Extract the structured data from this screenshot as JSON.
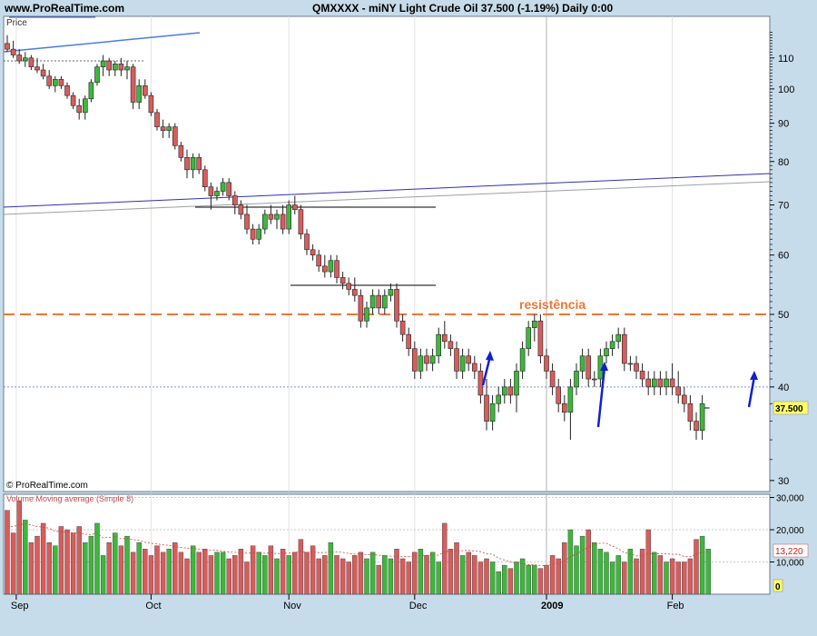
{
  "header": {
    "site": "www.ProRealTime.com",
    "title": "QMXXXX - miNY Light Crude Oil   37.500 (-1.19%)   Daily  0:00"
  },
  "price_panel": {
    "label": "Price",
    "credit": "© ProRealTime.com",
    "last_price_label": "37.500",
    "annotation": "resistência"
  },
  "volume_panel": {
    "label": "Volume Moving average (Simple 8)",
    "ma_value_label": "13,220",
    "zero_label": "0"
  },
  "colors": {
    "up": "#3cb83c",
    "down": "#d95c5c",
    "resistance": "#ee7733",
    "arrow": "#1020d0",
    "trend_blue": "#3030b0",
    "panel_bg": "#ffffff",
    "frame_bg": "#c7dcea"
  },
  "chart_data": [
    {
      "type": "candlestick",
      "scale": "log",
      "ylim": [
        29,
        125
      ],
      "y_ticks": [
        30,
        40,
        50,
        60,
        70,
        80,
        90,
        100,
        110
      ],
      "x_ticks": [
        "Sep",
        "Oct",
        "Nov",
        "Dec",
        "2009",
        "Feb"
      ],
      "resistance_level": 50,
      "reference_level": 40,
      "last_price": 37.5,
      "candles": [
        {
          "o": 115,
          "h": 118,
          "l": 112,
          "c": 113
        },
        {
          "o": 113,
          "h": 116,
          "l": 110,
          "c": 111
        },
        {
          "o": 111,
          "h": 113,
          "l": 108,
          "c": 109
        },
        {
          "o": 109,
          "h": 112,
          "l": 107,
          "c": 110
        },
        {
          "o": 110,
          "h": 111,
          "l": 106,
          "c": 107
        },
        {
          "o": 107,
          "h": 110,
          "l": 105,
          "c": 106
        },
        {
          "o": 106,
          "h": 108,
          "l": 103,
          "c": 104
        },
        {
          "o": 104,
          "h": 106,
          "l": 100,
          "c": 101
        },
        {
          "o": 101,
          "h": 104,
          "l": 99,
          "c": 103
        },
        {
          "o": 103,
          "h": 104,
          "l": 100,
          "c": 101
        },
        {
          "o": 101,
          "h": 102,
          "l": 97,
          "c": 98
        },
        {
          "o": 98,
          "h": 99,
          "l": 94,
          "c": 95
        },
        {
          "o": 95,
          "h": 97,
          "l": 91,
          "c": 93
        },
        {
          "o": 93,
          "h": 98,
          "l": 91,
          "c": 97
        },
        {
          "o": 97,
          "h": 103,
          "l": 96,
          "c": 102
        },
        {
          "o": 102,
          "h": 108,
          "l": 101,
          "c": 107
        },
        {
          "o": 107,
          "h": 111,
          "l": 104,
          "c": 109
        },
        {
          "o": 109,
          "h": 110,
          "l": 104,
          "c": 106
        },
        {
          "o": 106,
          "h": 109,
          "l": 104,
          "c": 108
        },
        {
          "o": 108,
          "h": 110,
          "l": 104,
          "c": 106
        },
        {
          "o": 106,
          "h": 109,
          "l": 103,
          "c": 107
        },
        {
          "o": 107,
          "h": 108,
          "l": 94,
          "c": 96
        },
        {
          "o": 96,
          "h": 103,
          "l": 94,
          "c": 101
        },
        {
          "o": 101,
          "h": 103,
          "l": 97,
          "c": 98
        },
        {
          "o": 98,
          "h": 99,
          "l": 92,
          "c": 93
        },
        {
          "o": 93,
          "h": 94,
          "l": 88,
          "c": 89
        },
        {
          "o": 89,
          "h": 91,
          "l": 86,
          "c": 88
        },
        {
          "o": 88,
          "h": 90,
          "l": 86,
          "c": 89
        },
        {
          "o": 89,
          "h": 90,
          "l": 83,
          "c": 84
        },
        {
          "o": 84,
          "h": 85,
          "l": 80,
          "c": 81
        },
        {
          "o": 81,
          "h": 83,
          "l": 76,
          "c": 78
        },
        {
          "o": 78,
          "h": 82,
          "l": 76,
          "c": 81
        },
        {
          "o": 81,
          "h": 82,
          "l": 77,
          "c": 78
        },
        {
          "o": 78,
          "h": 79,
          "l": 73,
          "c": 74
        },
        {
          "o": 74,
          "h": 75,
          "l": 69,
          "c": 72
        },
        {
          "o": 72,
          "h": 74,
          "l": 71,
          "c": 73
        },
        {
          "o": 73,
          "h": 76,
          "l": 72,
          "c": 75
        },
        {
          "o": 75,
          "h": 76,
          "l": 71,
          "c": 72
        },
        {
          "o": 72,
          "h": 73,
          "l": 68,
          "c": 70
        },
        {
          "o": 70,
          "h": 71,
          "l": 67,
          "c": 68
        },
        {
          "o": 68,
          "h": 70,
          "l": 64,
          "c": 65
        },
        {
          "o": 65,
          "h": 66,
          "l": 62,
          "c": 63
        },
        {
          "o": 63,
          "h": 66,
          "l": 62,
          "c": 65
        },
        {
          "o": 65,
          "h": 69,
          "l": 64,
          "c": 68
        },
        {
          "o": 68,
          "h": 70,
          "l": 66,
          "c": 67
        },
        {
          "o": 67,
          "h": 69,
          "l": 65,
          "c": 68
        },
        {
          "o": 68,
          "h": 70,
          "l": 64,
          "c": 65
        },
        {
          "o": 65,
          "h": 71,
          "l": 64,
          "c": 70
        },
        {
          "o": 70,
          "h": 72,
          "l": 68,
          "c": 69
        },
        {
          "o": 69,
          "h": 70,
          "l": 63,
          "c": 64
        },
        {
          "o": 64,
          "h": 65,
          "l": 60,
          "c": 61
        },
        {
          "o": 61,
          "h": 62,
          "l": 59,
          "c": 60
        },
        {
          "o": 60,
          "h": 61,
          "l": 57,
          "c": 58
        },
        {
          "o": 58,
          "h": 60,
          "l": 56,
          "c": 57
        },
        {
          "o": 57,
          "h": 60,
          "l": 56,
          "c": 59
        },
        {
          "o": 59,
          "h": 60,
          "l": 55,
          "c": 56
        },
        {
          "o": 56,
          "h": 57,
          "l": 54,
          "c": 55
        },
        {
          "o": 55,
          "h": 56,
          "l": 53,
          "c": 54
        },
        {
          "o": 54,
          "h": 56,
          "l": 52,
          "c": 53
        },
        {
          "o": 53,
          "h": 54,
          "l": 48,
          "c": 49
        },
        {
          "o": 49,
          "h": 52,
          "l": 48,
          "c": 51
        },
        {
          "o": 51,
          "h": 54,
          "l": 50,
          "c": 53
        },
        {
          "o": 53,
          "h": 54,
          "l": 50,
          "c": 51
        },
        {
          "o": 51,
          "h": 54,
          "l": 50,
          "c": 53
        },
        {
          "o": 53,
          "h": 55,
          "l": 52,
          "c": 54
        },
        {
          "o": 54,
          "h": 55,
          "l": 48,
          "c": 49
        },
        {
          "o": 49,
          "h": 50,
          "l": 46,
          "c": 47
        },
        {
          "o": 47,
          "h": 48,
          "l": 44,
          "c": 45
        },
        {
          "o": 45,
          "h": 46,
          "l": 41,
          "c": 42
        },
        {
          "o": 42,
          "h": 45,
          "l": 41,
          "c": 44
        },
        {
          "o": 44,
          "h": 45,
          "l": 42,
          "c": 43
        },
        {
          "o": 43,
          "h": 45,
          "l": 42,
          "c": 44
        },
        {
          "o": 44,
          "h": 48,
          "l": 43,
          "c": 47
        },
        {
          "o": 47,
          "h": 49,
          "l": 45,
          "c": 46
        },
        {
          "o": 46,
          "h": 47,
          "l": 44,
          "c": 45
        },
        {
          "o": 45,
          "h": 46,
          "l": 41,
          "c": 42
        },
        {
          "o": 42,
          "h": 45,
          "l": 41,
          "c": 44
        },
        {
          "o": 44,
          "h": 45,
          "l": 42,
          "c": 43
        },
        {
          "o": 43,
          "h": 44,
          "l": 41,
          "c": 42
        },
        {
          "o": 42,
          "h": 43,
          "l": 38,
          "c": 39
        },
        {
          "o": 39,
          "h": 41,
          "l": 35,
          "c": 36
        },
        {
          "o": 36,
          "h": 39,
          "l": 35,
          "c": 38
        },
        {
          "o": 38,
          "h": 40,
          "l": 37,
          "c": 39
        },
        {
          "o": 39,
          "h": 41,
          "l": 38,
          "c": 40
        },
        {
          "o": 40,
          "h": 41,
          "l": 38,
          "c": 39
        },
        {
          "o": 39,
          "h": 43,
          "l": 37,
          "c": 42
        },
        {
          "o": 42,
          "h": 46,
          "l": 41,
          "c": 45
        },
        {
          "o": 45,
          "h": 49,
          "l": 44,
          "c": 48
        },
        {
          "o": 48,
          "h": 50,
          "l": 46,
          "c": 49
        },
        {
          "o": 49,
          "h": 50,
          "l": 43,
          "c": 44
        },
        {
          "o": 44,
          "h": 45,
          "l": 41,
          "c": 42
        },
        {
          "o": 42,
          "h": 43,
          "l": 39,
          "c": 40
        },
        {
          "o": 40,
          "h": 41,
          "l": 37,
          "c": 38
        },
        {
          "o": 38,
          "h": 39,
          "l": 36,
          "c": 37
        },
        {
          "o": 37,
          "h": 41,
          "l": 34,
          "c": 40
        },
        {
          "o": 40,
          "h": 43,
          "l": 39,
          "c": 42
        },
        {
          "o": 42,
          "h": 45,
          "l": 41,
          "c": 44
        },
        {
          "o": 44,
          "h": 45,
          "l": 40,
          "c": 41
        },
        {
          "o": 41,
          "h": 42,
          "l": 40,
          "c": 41
        },
        {
          "o": 41,
          "h": 45,
          "l": 40,
          "c": 44
        },
        {
          "o": 44,
          "h": 46,
          "l": 43,
          "c": 45
        },
        {
          "o": 45,
          "h": 47,
          "l": 44,
          "c": 46
        },
        {
          "o": 46,
          "h": 48,
          "l": 45,
          "c": 47
        },
        {
          "o": 47,
          "h": 48,
          "l": 42,
          "c": 43
        },
        {
          "o": 43,
          "h": 44,
          "l": 42,
          "c": 43
        },
        {
          "o": 43,
          "h": 44,
          "l": 41,
          "c": 42
        },
        {
          "o": 42,
          "h": 43,
          "l": 40,
          "c": 41
        },
        {
          "o": 41,
          "h": 42,
          "l": 39,
          "c": 40
        },
        {
          "o": 40,
          "h": 42,
          "l": 39,
          "c": 41
        },
        {
          "o": 41,
          "h": 42,
          "l": 39,
          "c": 40
        },
        {
          "o": 40,
          "h": 42,
          "l": 39,
          "c": 41
        },
        {
          "o": 41,
          "h": 43,
          "l": 39,
          "c": 40
        },
        {
          "o": 40,
          "h": 42,
          "l": 38,
          "c": 39
        },
        {
          "o": 39,
          "h": 40,
          "l": 37,
          "c": 38
        },
        {
          "o": 38,
          "h": 39,
          "l": 35,
          "c": 36
        },
        {
          "o": 36,
          "h": 37,
          "l": 34,
          "c": 35
        },
        {
          "o": 35,
          "h": 39,
          "l": 34,
          "c": 38
        }
      ]
    },
    {
      "type": "bar",
      "title": "Volume Moving average (Simple 8)",
      "ylim": [
        0,
        31000
      ],
      "y_ticks": [
        0,
        10000,
        20000,
        30000
      ],
      "y_tick_labels": [
        "0",
        "10,000",
        "20,000",
        "30,000"
      ],
      "ma_last": 13220,
      "volume": [
        26000,
        19000,
        29000,
        23000,
        16000,
        18000,
        22000,
        16000,
        15000,
        21000,
        20000,
        19000,
        21000,
        16000,
        18000,
        22000,
        12000,
        16000,
        19000,
        15000,
        18000,
        13000,
        16000,
        14000,
        12000,
        15000,
        13000,
        14000,
        16000,
        13000,
        11000,
        15000,
        13000,
        14000,
        12000,
        13000,
        13000,
        11000,
        12000,
        14000,
        10000,
        15000,
        13000,
        12000,
        15000,
        11000,
        14000,
        12000,
        13000,
        17000,
        13000,
        15000,
        11000,
        12000,
        16000,
        12000,
        11000,
        10000,
        12000,
        13000,
        11000,
        13000,
        9000,
        12000,
        11000,
        14000,
        11000,
        10000,
        13000,
        14000,
        12000,
        13000,
        10000,
        22000,
        14000,
        16000,
        12000,
        13000,
        12000,
        10000,
        11000,
        10000,
        7000,
        9000,
        8000,
        10000,
        11000,
        9000,
        9000,
        8000,
        9000,
        12000,
        11000,
        16000,
        20000,
        15000,
        18000,
        20000,
        16000,
        14000,
        13000,
        10000,
        12000,
        10000,
        14000,
        11000,
        14000,
        20000,
        13000,
        12000,
        10000,
        11000,
        10000,
        10000,
        11000,
        17000,
        18000,
        14000
      ],
      "ma": [
        21000,
        21000,
        21500,
        21800,
        21500,
        21000,
        20800,
        20500,
        19500,
        19500,
        19200,
        19000,
        19100,
        18600,
        18500,
        18900,
        17500,
        17600,
        17900,
        17200,
        17300,
        16900,
        16700,
        16100,
        15800,
        15600,
        15300,
        15200,
        14700,
        14500,
        14300,
        14200,
        14000,
        13800,
        13700,
        13600,
        13300,
        13100,
        13000,
        12900,
        12700,
        12800,
        12800,
        12700,
        12800,
        12600,
        12700,
        12700,
        12900,
        13300,
        13000,
        13100,
        12900,
        12900,
        13200,
        13100,
        13000,
        12600,
        12400,
        12500,
        12300,
        12300,
        12100,
        11900,
        11800,
        11800,
        11700,
        11600,
        11800,
        12000,
        12100,
        12200,
        12100,
        13200,
        13300,
        13600,
        13500,
        13600,
        13400,
        13200,
        12600,
        12400,
        11200,
        10600,
        10100,
        9500,
        9500,
        9200,
        9100,
        8900,
        8900,
        9300,
        9500,
        10400,
        11600,
        12500,
        13500,
        14700,
        15400,
        15800,
        15800,
        14900,
        14100,
        12900,
        12500,
        11900,
        11900,
        12700,
        12500,
        12600,
        12500,
        12400,
        12400,
        11700,
        11600,
        12500,
        13000,
        13220
      ]
    }
  ]
}
